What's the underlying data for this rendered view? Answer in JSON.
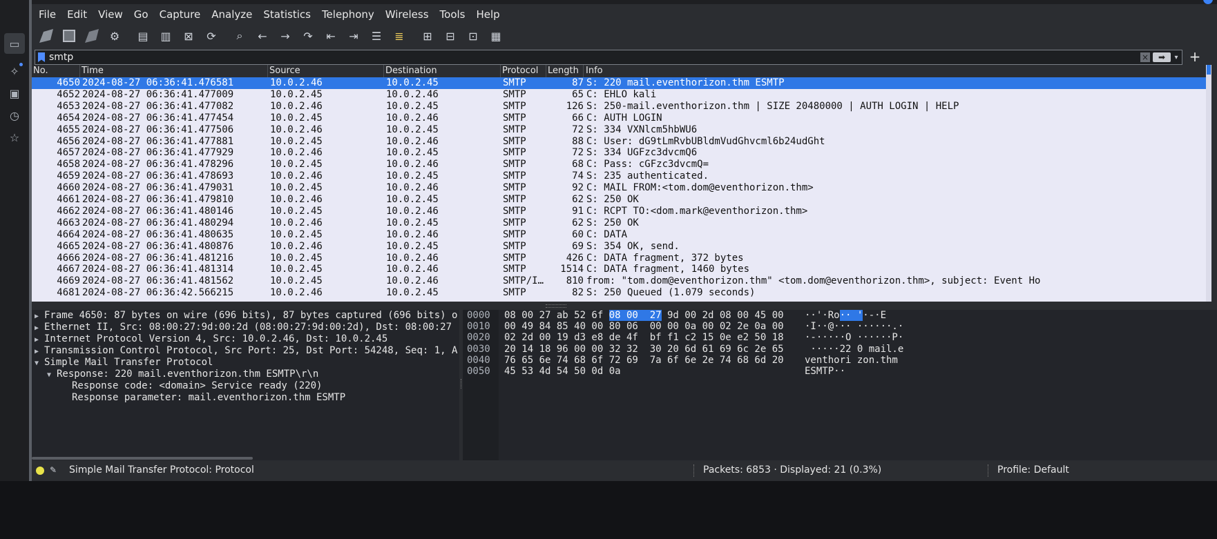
{
  "menu": [
    "File",
    "Edit",
    "View",
    "Go",
    "Capture",
    "Analyze",
    "Statistics",
    "Telephony",
    "Wireless",
    "Tools",
    "Help"
  ],
  "toolbar_icons": [
    "start-capture-icon",
    "stop-capture-icon",
    "restart-capture-icon",
    "capture-options-icon",
    "open-file-icon",
    "save-file-icon",
    "close-file-icon",
    "reload-file-icon",
    "find-packet-icon",
    "go-back-icon",
    "go-forward-icon",
    "go-to-packet-icon",
    "first-packet-icon",
    "last-packet-icon",
    "autoscroll-icon",
    "colorize-icon",
    "zoom-in-icon",
    "zoom-out-icon",
    "normal-size-icon",
    "resize-columns-icon"
  ],
  "filter": {
    "value": "smtp"
  },
  "columns": {
    "no": "No.",
    "time": "Time",
    "source": "Source",
    "destination": "Destination",
    "protocol": "Protocol",
    "length": "Length",
    "info": "Info"
  },
  "packets": [
    {
      "no": "4650",
      "time": "2024-08-27 06:36:41.476581",
      "src": "10.0.2.46",
      "dst": "10.0.2.45",
      "proto": "SMTP",
      "len": "87",
      "info": "S: 220 mail.eventhorizon.thm ESMTP",
      "selected": true
    },
    {
      "no": "4652",
      "time": "2024-08-27 06:36:41.477009",
      "src": "10.0.2.45",
      "dst": "10.0.2.46",
      "proto": "SMTP",
      "len": "65",
      "info": "C: EHLO kali"
    },
    {
      "no": "4653",
      "time": "2024-08-27 06:36:41.477082",
      "src": "10.0.2.46",
      "dst": "10.0.2.45",
      "proto": "SMTP",
      "len": "126",
      "info": "S: 250-mail.eventhorizon.thm | SIZE 20480000 | AUTH LOGIN | HELP"
    },
    {
      "no": "4654",
      "time": "2024-08-27 06:36:41.477454",
      "src": "10.0.2.45",
      "dst": "10.0.2.46",
      "proto": "SMTP",
      "len": "66",
      "info": "C: AUTH LOGIN"
    },
    {
      "no": "4655",
      "time": "2024-08-27 06:36:41.477506",
      "src": "10.0.2.46",
      "dst": "10.0.2.45",
      "proto": "SMTP",
      "len": "72",
      "info": "S: 334 VXNlcm5hbWU6"
    },
    {
      "no": "4656",
      "time": "2024-08-27 06:36:41.477881",
      "src": "10.0.2.45",
      "dst": "10.0.2.46",
      "proto": "SMTP",
      "len": "88",
      "info": "C: User: dG9tLmRvbUBldmVudGhvcml6b24udGht"
    },
    {
      "no": "4657",
      "time": "2024-08-27 06:36:41.477929",
      "src": "10.0.2.46",
      "dst": "10.0.2.45",
      "proto": "SMTP",
      "len": "72",
      "info": "S: 334 UGFzc3dvcmQ6"
    },
    {
      "no": "4658",
      "time": "2024-08-27 06:36:41.478296",
      "src": "10.0.2.45",
      "dst": "10.0.2.46",
      "proto": "SMTP",
      "len": "68",
      "info": "C: Pass: cGFzc3dvcmQ="
    },
    {
      "no": "4659",
      "time": "2024-08-27 06:36:41.478693",
      "src": "10.0.2.46",
      "dst": "10.0.2.45",
      "proto": "SMTP",
      "len": "74",
      "info": "S: 235 authenticated."
    },
    {
      "no": "4660",
      "time": "2024-08-27 06:36:41.479031",
      "src": "10.0.2.45",
      "dst": "10.0.2.46",
      "proto": "SMTP",
      "len": "92",
      "info": "C: MAIL FROM:<tom.dom@eventhorizon.thm>"
    },
    {
      "no": "4661",
      "time": "2024-08-27 06:36:41.479810",
      "src": "10.0.2.46",
      "dst": "10.0.2.45",
      "proto": "SMTP",
      "len": "62",
      "info": "S: 250 OK"
    },
    {
      "no": "4662",
      "time": "2024-08-27 06:36:41.480146",
      "src": "10.0.2.45",
      "dst": "10.0.2.46",
      "proto": "SMTP",
      "len": "91",
      "info": "C: RCPT TO:<dom.mark@eventhorizon.thm>"
    },
    {
      "no": "4663",
      "time": "2024-08-27 06:36:41.480294",
      "src": "10.0.2.46",
      "dst": "10.0.2.45",
      "proto": "SMTP",
      "len": "62",
      "info": "S: 250 OK"
    },
    {
      "no": "4664",
      "time": "2024-08-27 06:36:41.480635",
      "src": "10.0.2.45",
      "dst": "10.0.2.46",
      "proto": "SMTP",
      "len": "60",
      "info": "C: DATA"
    },
    {
      "no": "4665",
      "time": "2024-08-27 06:36:41.480876",
      "src": "10.0.2.46",
      "dst": "10.0.2.45",
      "proto": "SMTP",
      "len": "69",
      "info": "S: 354 OK, send."
    },
    {
      "no": "4666",
      "time": "2024-08-27 06:36:41.481216",
      "src": "10.0.2.45",
      "dst": "10.0.2.46",
      "proto": "SMTP",
      "len": "426",
      "info": "C: DATA fragment, 372 bytes"
    },
    {
      "no": "4667",
      "time": "2024-08-27 06:36:41.481314",
      "src": "10.0.2.45",
      "dst": "10.0.2.46",
      "proto": "SMTP",
      "len": "1514",
      "info": "C: DATA fragment, 1460 bytes"
    },
    {
      "no": "4669",
      "time": "2024-08-27 06:36:41.481562",
      "src": "10.0.2.45",
      "dst": "10.0.2.46",
      "proto": "SMTP/I…",
      "len": "810",
      "info": "from: \"tom.dom@eventhorizon.thm\" <tom.dom@eventhorizon.thm>, subject: Event Ho"
    },
    {
      "no": "4681",
      "time": "2024-08-27 06:36:42.566215",
      "src": "10.0.2.46",
      "dst": "10.0.2.45",
      "proto": "SMTP",
      "len": "82",
      "info": "S: 250 Queued (1.079 seconds)"
    }
  ],
  "details": [
    {
      "indent": 0,
      "arrow": "right",
      "text": "Frame 4650: 87 bytes on wire (696 bits), 87 bytes captured (696 bits) o"
    },
    {
      "indent": 0,
      "arrow": "right",
      "text": "Ethernet II, Src: 08:00:27:9d:00:2d (08:00:27:9d:00:2d), Dst: 08:00:27"
    },
    {
      "indent": 0,
      "arrow": "right",
      "text": "Internet Protocol Version 4, Src: 10.0.2.46, Dst: 10.0.2.45"
    },
    {
      "indent": 0,
      "arrow": "right",
      "text": "Transmission Control Protocol, Src Port: 25, Dst Port: 54248, Seq: 1, A"
    },
    {
      "indent": 0,
      "arrow": "down",
      "text": "Simple Mail Transfer Protocol"
    },
    {
      "indent": 1,
      "arrow": "down",
      "text": "Response: 220 mail.eventhorizon.thm ESMTP\\r\\n"
    },
    {
      "indent": 2,
      "arrow": "none",
      "text": "Response code: <domain> Service ready (220)"
    },
    {
      "indent": 2,
      "arrow": "none",
      "text": "Response parameter: mail.eventhorizon.thm ESMTP"
    }
  ],
  "bytes": [
    {
      "offset": "0000",
      "pre": "08 00 27 ab 52 6f ",
      "hl": "08 00  27",
      "post": " 9d 00 2d 08 00 45 00",
      "ascii_pre": "··'·Ro",
      "ascii_hl": "·· '",
      "ascii_post": "·-·E"
    },
    {
      "offset": "0010",
      "pre": "00 49 84 85 40 00 80 06  00 00 0a 00 02 2e 0a 00",
      "hl": "",
      "post": "",
      "ascii_pre": "·I··@··· ······.·",
      "ascii_hl": "",
      "ascii_post": ""
    },
    {
      "offset": "0020",
      "pre": "02 2d 00 19 d3 e8 de 4f  bf f1 c2 15 0e e2 50 18",
      "hl": "",
      "post": "",
      "ascii_pre": "·-·····O ······P·",
      "ascii_hl": "",
      "ascii_post": ""
    },
    {
      "offset": "0030",
      "pre": "20 14 18 96 00 00 32 32  30 20 6d 61 69 6c 2e 65",
      "hl": "",
      "post": "",
      "ascii_pre": " ·····22 0 mail.e",
      "ascii_hl": "",
      "ascii_post": ""
    },
    {
      "offset": "0040",
      "pre": "76 65 6e 74 68 6f 72 69  7a 6f 6e 2e 74 68 6d 20",
      "hl": "",
      "post": "",
      "ascii_pre": "venthori zon.thm ",
      "ascii_hl": "",
      "ascii_post": ""
    },
    {
      "offset": "0050",
      "pre": "45 53 4d 54 50 0d 0a",
      "hl": "",
      "post": "",
      "ascii_pre": "ESMTP··",
      "ascii_hl": "",
      "ascii_post": ""
    }
  ],
  "status": {
    "field": "Simple Mail Transfer Protocol: Protocol",
    "packets": "Packets: 6853 · Displayed: 21 (0.3%)",
    "profile": "Profile: Default"
  }
}
